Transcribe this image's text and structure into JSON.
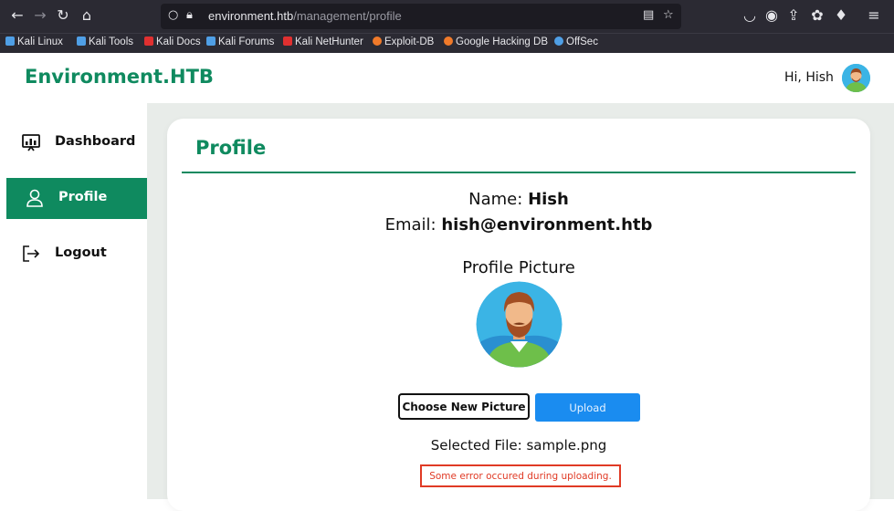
{
  "browser": {
    "url_host": "environment.htb",
    "url_path": "/management/profile",
    "bookmarks": [
      {
        "label": "Kali Linux",
        "color": "#4f9fe6"
      },
      {
        "label": "Kali Tools",
        "color": "#4f9fe6"
      },
      {
        "label": "Kali Docs",
        "color": "#e03030"
      },
      {
        "label": "Kali Forums",
        "color": "#4f9fe6"
      },
      {
        "label": "Kali NetHunter",
        "color": "#e03030"
      },
      {
        "label": "Exploit-DB",
        "color": "#f07a2a"
      },
      {
        "label": "Google Hacking DB",
        "color": "#f07a2a"
      },
      {
        "label": "OffSec",
        "color": "#4f9fe6"
      }
    ]
  },
  "header": {
    "brand": "Environment.HTB",
    "greeting": "Hi, Hish"
  },
  "sidebar": {
    "items": [
      {
        "label": "Dashboard",
        "icon": "monitor-chart-icon"
      },
      {
        "label": "Profile",
        "icon": "user-icon",
        "active": true
      },
      {
        "label": "Logout",
        "icon": "logout-icon"
      }
    ]
  },
  "profile": {
    "title": "Profile",
    "name_label": "Name:",
    "name_value": "Hish",
    "email_label": "Email:",
    "email_value": "hish@environment.htb",
    "picture_label": "Profile Picture",
    "choose_button": "Choose New Picture",
    "upload_button": "Upload",
    "selected_file_label": "Selected File:",
    "selected_file_value": "sample.png",
    "error_message": "Some error occured during uploading."
  },
  "colors": {
    "brand": "#0f8a5f",
    "upload_button": "#1a8cf0",
    "error": "#e03a25"
  }
}
